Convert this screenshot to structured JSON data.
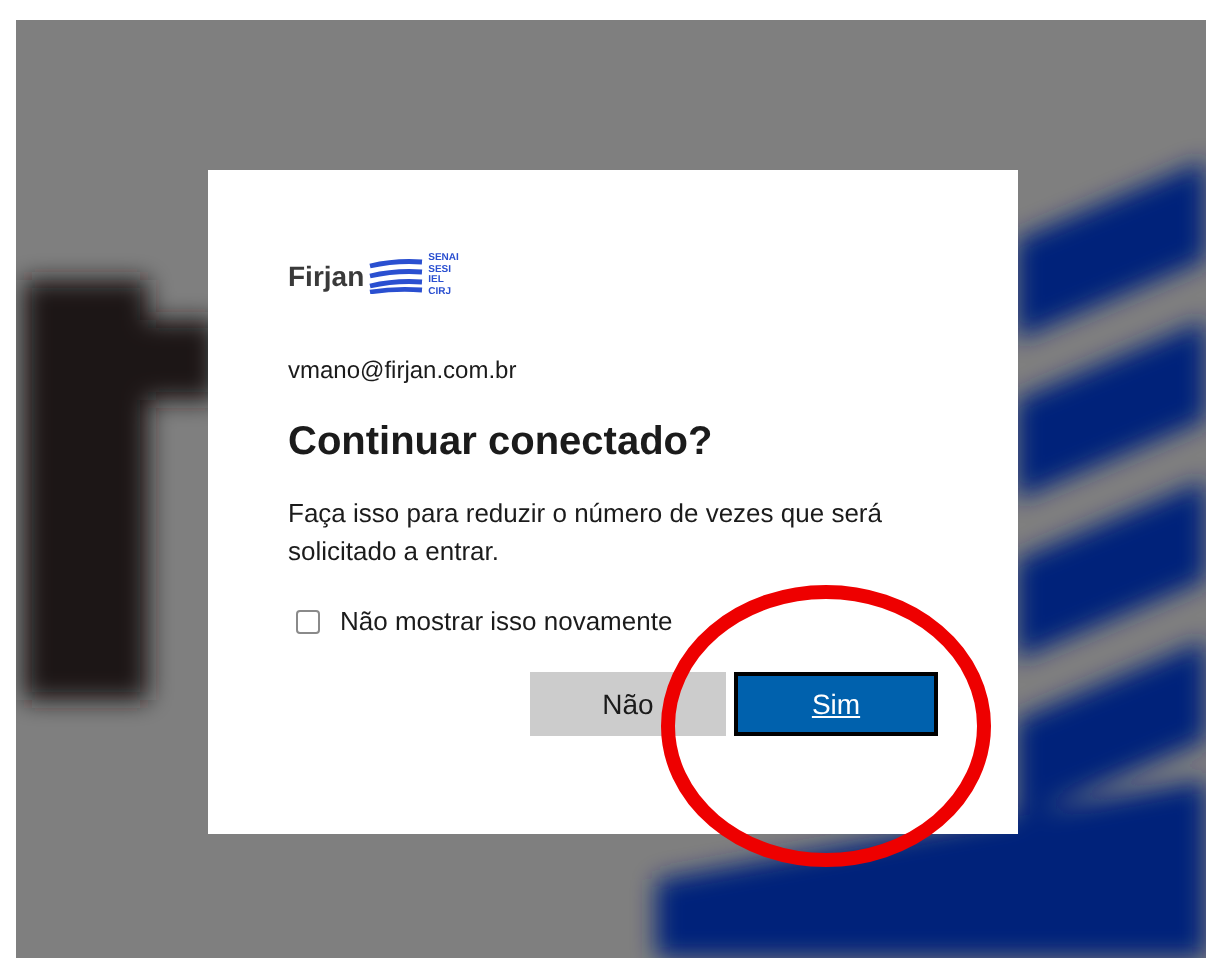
{
  "dialog": {
    "logo": {
      "name": "Firjan",
      "units": [
        "SENAI",
        "SESI",
        "IEL",
        "CIRJ"
      ]
    },
    "account": "vmano@firjan.com.br",
    "title": "Continuar conectado?",
    "message": "Faça isso para reduzir o número de vezes que será solicitado a entrar.",
    "checkbox": {
      "label": "Não mostrar isso novamente",
      "checked": false
    },
    "buttons": [
      {
        "label": "Não",
        "kind": "secondary"
      },
      {
        "label": "Sim",
        "kind": "primary"
      }
    ]
  }
}
